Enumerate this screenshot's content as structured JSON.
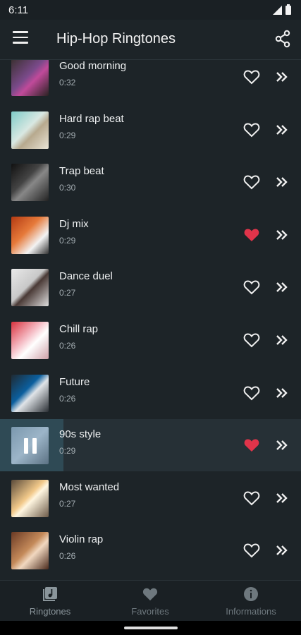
{
  "status_bar": {
    "time": "6:11"
  },
  "app_bar": {
    "title": "Hip-Hop Ringtones"
  },
  "ringtones": [
    {
      "name": "Good morning",
      "duration": "0:32",
      "favorite": false,
      "playing": false
    },
    {
      "name": "Hard rap beat",
      "duration": "0:29",
      "favorite": false,
      "playing": false
    },
    {
      "name": "Trap beat",
      "duration": "0:30",
      "favorite": false,
      "playing": false
    },
    {
      "name": "Dj mix",
      "duration": "0:29",
      "favorite": true,
      "playing": false
    },
    {
      "name": "Dance duel",
      "duration": "0:27",
      "favorite": false,
      "playing": false
    },
    {
      "name": "Chill rap",
      "duration": "0:26",
      "favorite": false,
      "playing": false
    },
    {
      "name": "Future",
      "duration": "0:26",
      "favorite": false,
      "playing": false
    },
    {
      "name": "90s style",
      "duration": "0:29",
      "favorite": true,
      "playing": true,
      "progress": 0.21
    },
    {
      "name": "Most wanted",
      "duration": "0:27",
      "favorite": false,
      "playing": false
    },
    {
      "name": "Violin rap",
      "duration": "0:26",
      "favorite": false,
      "playing": false
    }
  ],
  "bottom_nav": {
    "items": [
      {
        "label": "Ringtones",
        "icon": "music-library-icon"
      },
      {
        "label": "Favorites",
        "icon": "heart-icon"
      },
      {
        "label": "Informations",
        "icon": "info-icon"
      }
    ]
  },
  "colors": {
    "background": "#1d2428",
    "favorite": "#e0344a",
    "highlight_row": "#263036"
  }
}
